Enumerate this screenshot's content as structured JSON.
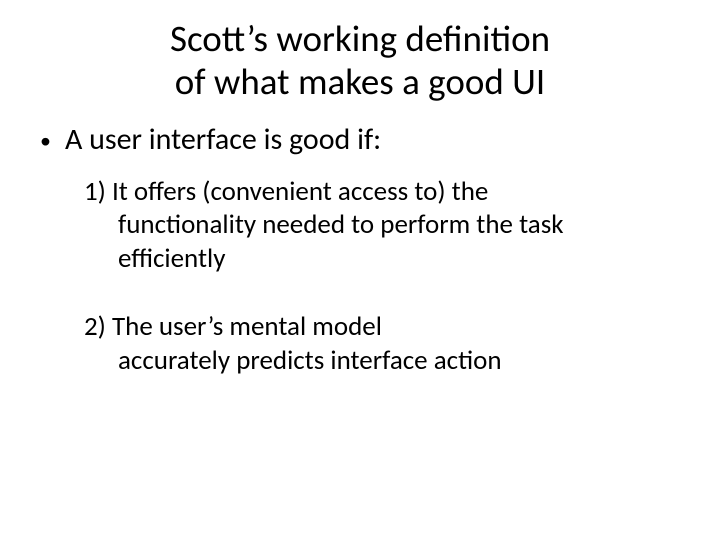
{
  "title_line1": "Scott’s working definition",
  "title_line2": "of what makes a good UI",
  "main_bullet": "A user interface is good if:",
  "items": [
    {
      "label": "1) It offers (convenient access to) the",
      "rest": "functionality needed to perform the task efficiently"
    },
    {
      "label": "2) The user’s mental model",
      "rest": "accurately predicts interface action"
    }
  ]
}
